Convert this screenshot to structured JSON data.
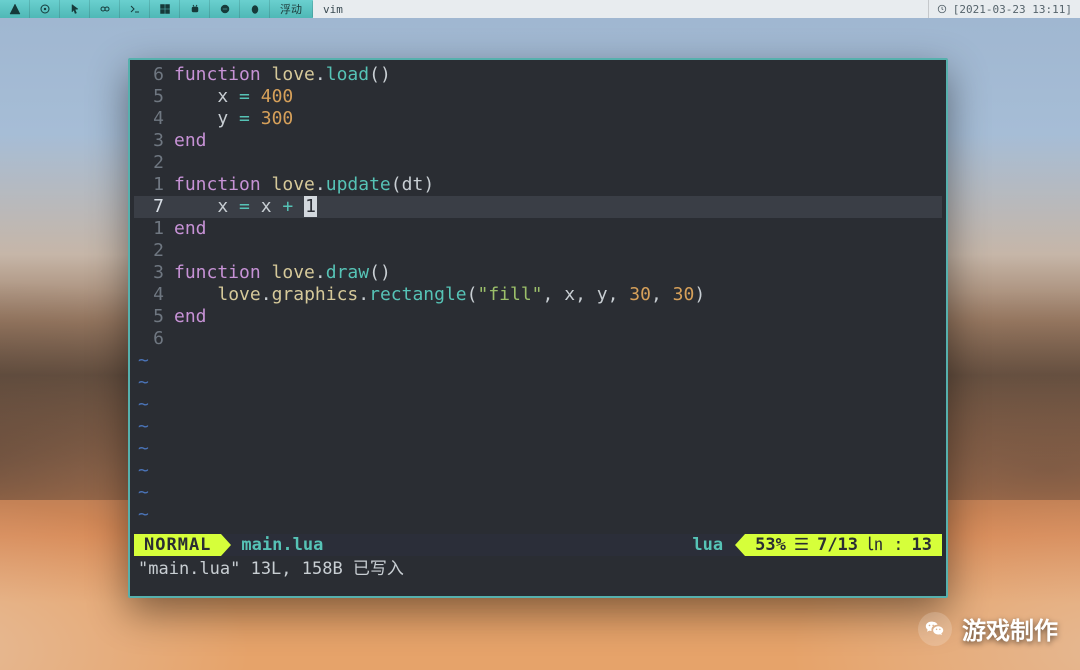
{
  "taskbar": {
    "float_label": "浮动",
    "title": "vim",
    "clock": "[2021-03-23 13:11]"
  },
  "editor": {
    "lines": [
      {
        "n": "6",
        "tokens": [
          [
            "kw",
            "function"
          ],
          [
            "pun",
            " "
          ],
          [
            "obj",
            "love"
          ],
          [
            "pun",
            "."
          ],
          [
            "fn",
            "load"
          ],
          [
            "pun",
            "()"
          ]
        ]
      },
      {
        "n": "5",
        "tokens": [
          [
            "pun",
            "    "
          ],
          [
            "id",
            "x"
          ],
          [
            "pun",
            " "
          ],
          [
            "op",
            "="
          ],
          [
            "pun",
            " "
          ],
          [
            "num",
            "400"
          ]
        ]
      },
      {
        "n": "4",
        "tokens": [
          [
            "pun",
            "    "
          ],
          [
            "id",
            "y"
          ],
          [
            "pun",
            " "
          ],
          [
            "op",
            "="
          ],
          [
            "pun",
            " "
          ],
          [
            "num",
            "300"
          ]
        ]
      },
      {
        "n": "3",
        "tokens": [
          [
            "kw",
            "end"
          ]
        ]
      },
      {
        "n": "2",
        "tokens": []
      },
      {
        "n": "1",
        "tokens": [
          [
            "kw",
            "function"
          ],
          [
            "pun",
            " "
          ],
          [
            "obj",
            "love"
          ],
          [
            "pun",
            "."
          ],
          [
            "fn",
            "update"
          ],
          [
            "pun",
            "("
          ],
          [
            "id",
            "dt"
          ],
          [
            "pun",
            ")"
          ]
        ]
      },
      {
        "n": "7",
        "current": true,
        "tokens": [
          [
            "pun",
            "    "
          ],
          [
            "id",
            "x"
          ],
          [
            "pun",
            " "
          ],
          [
            "op",
            "="
          ],
          [
            "pun",
            " "
          ],
          [
            "id",
            "x"
          ],
          [
            "pun",
            " "
          ],
          [
            "op",
            "+"
          ],
          [
            "pun",
            " "
          ],
          [
            "cursor",
            "1"
          ]
        ]
      },
      {
        "n": "1",
        "tokens": [
          [
            "kw",
            "end"
          ]
        ]
      },
      {
        "n": "2",
        "tokens": []
      },
      {
        "n": "3",
        "tokens": [
          [
            "kw",
            "function"
          ],
          [
            "pun",
            " "
          ],
          [
            "obj",
            "love"
          ],
          [
            "pun",
            "."
          ],
          [
            "fn",
            "draw"
          ],
          [
            "pun",
            "()"
          ]
        ]
      },
      {
        "n": "4",
        "tokens": [
          [
            "pun",
            "    "
          ],
          [
            "obj",
            "love"
          ],
          [
            "pun",
            "."
          ],
          [
            "obj",
            "graphics"
          ],
          [
            "pun",
            "."
          ],
          [
            "fn",
            "rectangle"
          ],
          [
            "pun",
            "("
          ],
          [
            "str",
            "\"fill\""
          ],
          [
            "pun",
            ", "
          ],
          [
            "id",
            "x"
          ],
          [
            "pun",
            ", "
          ],
          [
            "id",
            "y"
          ],
          [
            "pun",
            ", "
          ],
          [
            "num",
            "30"
          ],
          [
            "pun",
            ", "
          ],
          [
            "num",
            "30"
          ],
          [
            "pun",
            ")"
          ]
        ]
      },
      {
        "n": "5",
        "tokens": [
          [
            "kw",
            "end"
          ]
        ]
      },
      {
        "n": "6",
        "tokens": []
      }
    ],
    "tilde_rows": 8,
    "tilde_char": "~"
  },
  "status": {
    "mode": "NORMAL",
    "filename": "main.lua",
    "filetype": "lua",
    "percent": "53%",
    "line_indicator_glyph": "☰",
    "position": "7/13",
    "col_glyph": "㏑ :",
    "col": "13"
  },
  "message": "\"main.lua\" 13L, 158B 已写入",
  "watermark": "游戏制作"
}
